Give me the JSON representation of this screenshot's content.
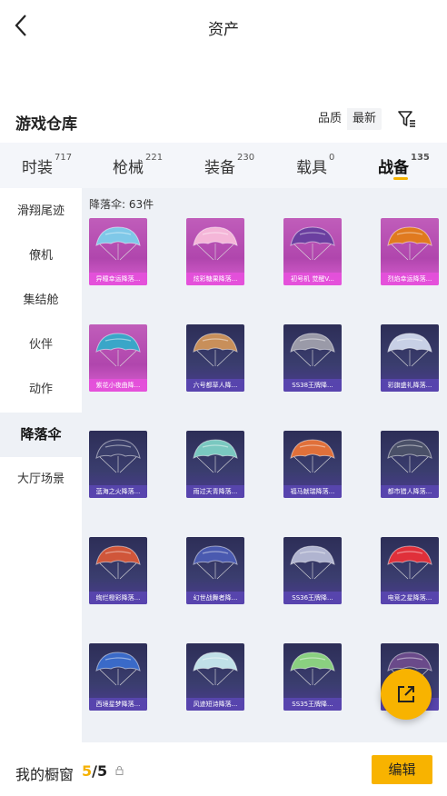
{
  "header": {
    "title": "资产"
  },
  "warehouse": {
    "title": "游戏仓库",
    "sort": [
      "品质",
      "最新"
    ]
  },
  "tabs": [
    {
      "label": "时装",
      "count": "717"
    },
    {
      "label": "枪械",
      "count": "221"
    },
    {
      "label": "装备",
      "count": "230"
    },
    {
      "label": "载具",
      "count": "0"
    },
    {
      "label": "战备",
      "count": "135"
    }
  ],
  "sidebar": [
    {
      "label": "滑翔尾迹"
    },
    {
      "label": "僚机"
    },
    {
      "label": "集结舱"
    },
    {
      "label": "伙伴"
    },
    {
      "label": "动作"
    },
    {
      "label": "降落伞"
    },
    {
      "label": "大厅场景"
    }
  ],
  "content": {
    "count_label": "降落伞: 63件",
    "items": [
      {
        "name": "异瞳幸运降落...",
        "tier": "pink",
        "color": "#7fc8e8"
      },
      {
        "name": "炫彩糖果降落...",
        "tier": "pink",
        "color": "#f4b6d8"
      },
      {
        "name": "初号机 觉醒V...",
        "tier": "pink",
        "color": "#6b3fa0"
      },
      {
        "name": "烈焰幸运降落...",
        "tier": "pink",
        "color": "#e07a1f"
      },
      {
        "name": "紫花小夜曲降...",
        "tier": "pink",
        "color": "#3aa6c8"
      },
      {
        "name": "六号都草人降...",
        "tier": "purple",
        "color": "#c88f5a"
      },
      {
        "name": "SS38王牌降...",
        "tier": "purple",
        "color": "#9a9aa8"
      },
      {
        "name": "彩旗盛礼降落...",
        "tier": "purple",
        "color": "#c8d0e6"
      },
      {
        "name": "蓝海之火降落...",
        "tier": "purple",
        "color": "#3a3e6a"
      },
      {
        "name": "雨过天青降落...",
        "tier": "purple",
        "color": "#7ac8c0"
      },
      {
        "name": "福马献瑞降落...",
        "tier": "purple",
        "color": "#e0703a"
      },
      {
        "name": "都市猎人降落...",
        "tier": "purple",
        "color": "#4a5068"
      },
      {
        "name": "绚烂橙彩降落...",
        "tier": "purple",
        "color": "#d0563a"
      },
      {
        "name": "幻世战舞者降...",
        "tier": "purple",
        "color": "#4a5ab0"
      },
      {
        "name": "SS36王牌降...",
        "tier": "purple",
        "color": "#b0b4d0"
      },
      {
        "name": "电竞之星降落...",
        "tier": "purple",
        "color": "#e0303a"
      },
      {
        "name": "西境星梦降落...",
        "tier": "purple",
        "color": "#3a6ac8"
      },
      {
        "name": "风迹短诗降落...",
        "tier": "purple",
        "color": "#c0e0e8"
      },
      {
        "name": "SS35王牌降...",
        "tier": "purple",
        "color": "#8ad080"
      },
      {
        "name": "",
        "tier": "purple",
        "color": "#6a4a8a"
      }
    ]
  },
  "footer": {
    "label": "我的橱窗",
    "current": "5",
    "total": "/5",
    "edit": "编辑"
  },
  "colors": {
    "accent": "#f8b300",
    "panel": "#eef1f6"
  },
  "icons": [
    "back-icon",
    "filter-icon",
    "lock-icon",
    "share-icon"
  ]
}
